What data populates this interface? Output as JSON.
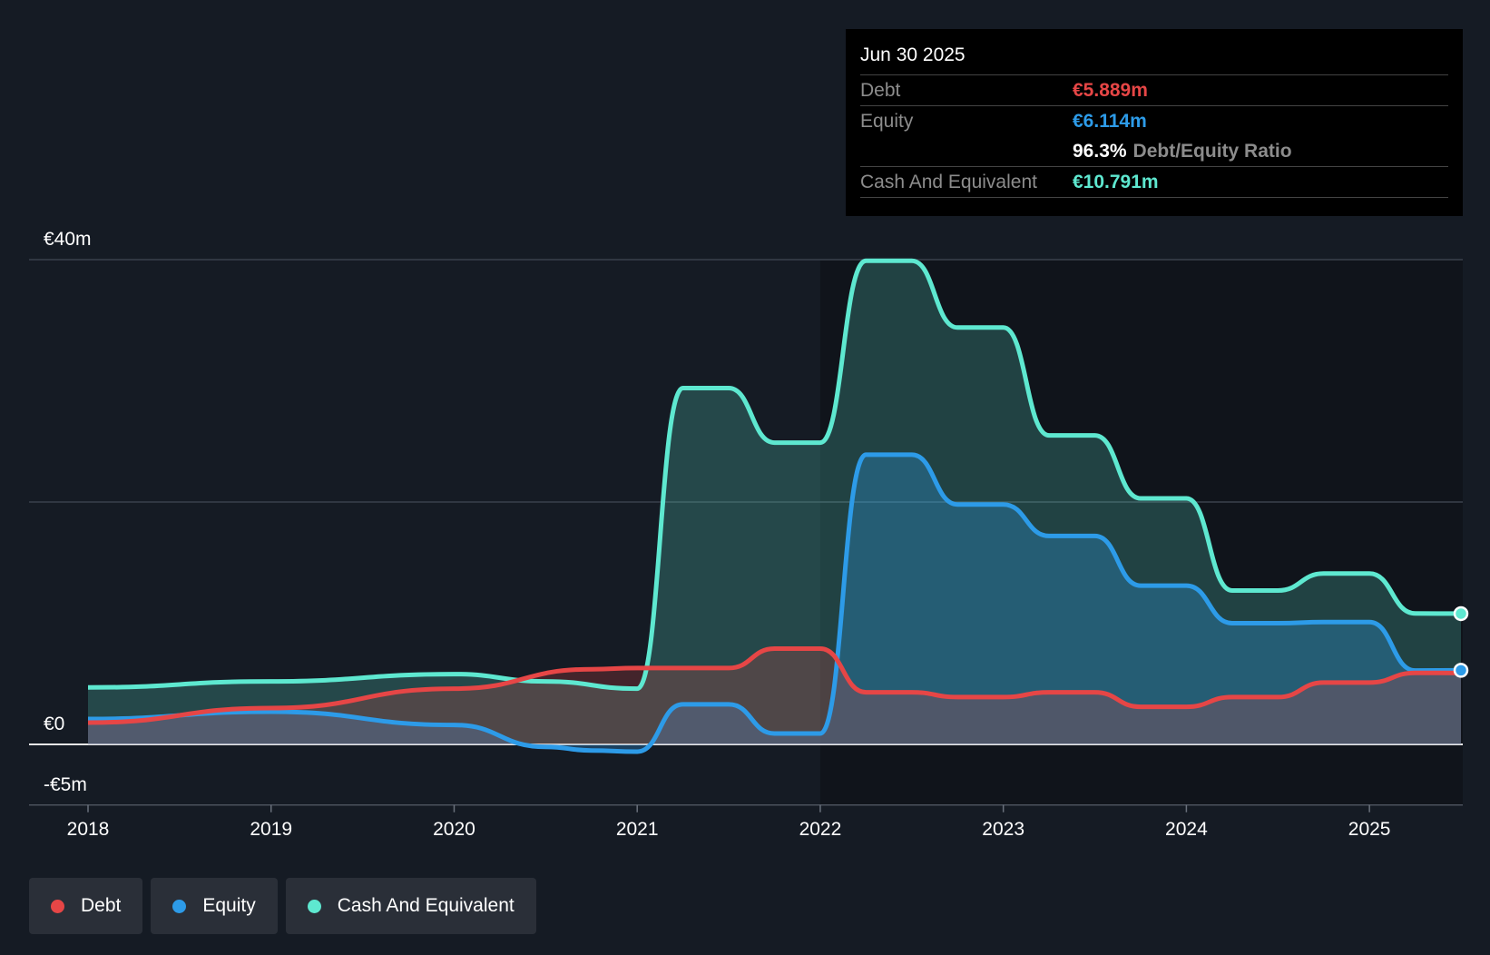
{
  "tooltip": {
    "date": "Jun 30 2025",
    "rows": [
      {
        "label": "Debt",
        "value": "€5.889m",
        "color": "#e64646"
      },
      {
        "label": "Equity",
        "value": "€6.114m",
        "color": "#2d9be8"
      }
    ],
    "ratio_value": "96.3%",
    "ratio_label": "Debt/Equity Ratio",
    "cash": {
      "label": "Cash And Equivalent",
      "value": "€10.791m",
      "color": "#5ee8d0"
    }
  },
  "legend": [
    {
      "label": "Debt",
      "color": "#e64646"
    },
    {
      "label": "Equity",
      "color": "#2d9be8"
    },
    {
      "label": "Cash And Equivalent",
      "color": "#5ee8d0"
    }
  ],
  "chart_data": {
    "type": "area",
    "x_ticks": [
      "2018",
      "2019",
      "2020",
      "2021",
      "2022",
      "2023",
      "2024",
      "2025"
    ],
    "y_ticks": [
      {
        "value": 40,
        "label": "€40m"
      },
      {
        "value": 0,
        "label": "€0"
      },
      {
        "value": -5,
        "label": "-€5m"
      }
    ],
    "ylim": [
      -5,
      40
    ],
    "xlim": [
      2018.0,
      2025.5
    ],
    "grid_values": [
      40,
      20
    ],
    "series": [
      {
        "name": "Debt",
        "color": "#e64646",
        "points": [
          [
            2018.0,
            1.8
          ],
          [
            2019.0,
            3.0
          ],
          [
            2020.0,
            4.6
          ],
          [
            2020.75,
            6.2
          ],
          [
            2021.0,
            6.3
          ],
          [
            2021.5,
            6.3
          ],
          [
            2021.75,
            7.9
          ],
          [
            2022.0,
            7.9
          ],
          [
            2022.25,
            4.3
          ],
          [
            2022.5,
            4.3
          ],
          [
            2022.75,
            3.9
          ],
          [
            2023.0,
            3.9
          ],
          [
            2023.25,
            4.3
          ],
          [
            2023.5,
            4.3
          ],
          [
            2023.75,
            3.1
          ],
          [
            2024.0,
            3.1
          ],
          [
            2024.25,
            3.9
          ],
          [
            2024.5,
            3.9
          ],
          [
            2024.75,
            5.1
          ],
          [
            2025.0,
            5.1
          ],
          [
            2025.25,
            5.9
          ],
          [
            2025.5,
            5.889
          ]
        ]
      },
      {
        "name": "Equity",
        "color": "#2d9be8",
        "points": [
          [
            2018.0,
            2.1
          ],
          [
            2019.0,
            2.7
          ],
          [
            2020.0,
            1.6
          ],
          [
            2020.5,
            -0.2
          ],
          [
            2020.75,
            -0.5
          ],
          [
            2021.0,
            -0.6
          ],
          [
            2021.25,
            3.3
          ],
          [
            2021.5,
            3.3
          ],
          [
            2021.75,
            0.9
          ],
          [
            2022.0,
            0.9
          ],
          [
            2022.25,
            23.9
          ],
          [
            2022.5,
            23.9
          ],
          [
            2022.75,
            19.8
          ],
          [
            2023.0,
            19.8
          ],
          [
            2023.25,
            17.2
          ],
          [
            2023.5,
            17.2
          ],
          [
            2023.75,
            13.1
          ],
          [
            2024.0,
            13.1
          ],
          [
            2024.25,
            10.0
          ],
          [
            2024.5,
            10.0
          ],
          [
            2024.75,
            10.1
          ],
          [
            2025.0,
            10.1
          ],
          [
            2025.25,
            6.1
          ],
          [
            2025.5,
            6.114
          ]
        ]
      },
      {
        "name": "Cash And Equivalent",
        "color": "#5ee8d0",
        "points": [
          [
            2018.0,
            4.7
          ],
          [
            2019.0,
            5.2
          ],
          [
            2020.0,
            5.8
          ],
          [
            2020.5,
            5.2
          ],
          [
            2021.0,
            4.6
          ],
          [
            2021.25,
            29.4
          ],
          [
            2021.5,
            29.4
          ],
          [
            2021.75,
            24.9
          ],
          [
            2022.0,
            24.9
          ],
          [
            2022.25,
            39.9
          ],
          [
            2022.5,
            39.9
          ],
          [
            2022.75,
            34.4
          ],
          [
            2023.0,
            34.4
          ],
          [
            2023.25,
            25.5
          ],
          [
            2023.5,
            25.5
          ],
          [
            2023.75,
            20.3
          ],
          [
            2024.0,
            20.3
          ],
          [
            2024.25,
            12.7
          ],
          [
            2024.5,
            12.7
          ],
          [
            2024.75,
            14.1
          ],
          [
            2025.0,
            14.1
          ],
          [
            2025.25,
            10.8
          ],
          [
            2025.5,
            10.791
          ]
        ]
      }
    ]
  }
}
